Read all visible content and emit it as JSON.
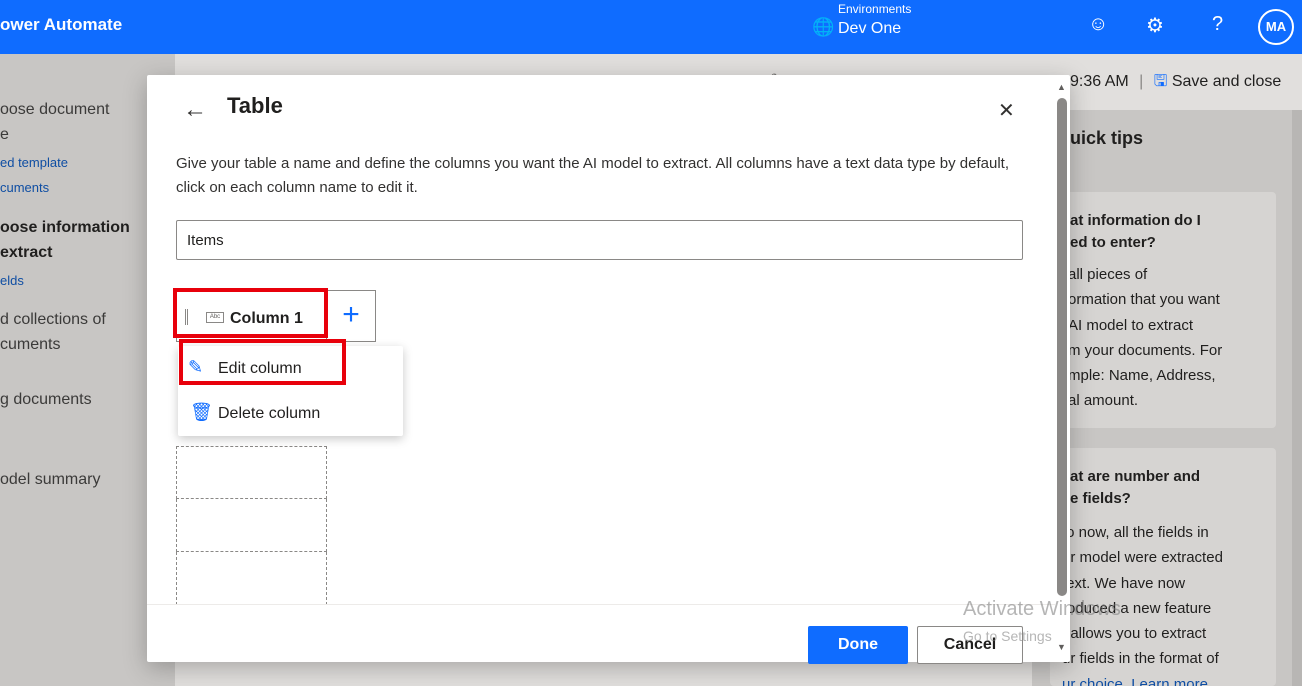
{
  "app": {
    "brand": "ower Automate"
  },
  "topbar": {
    "env_label": "Environments",
    "env_name": "Dev One",
    "avatar": "MA",
    "help": "?"
  },
  "leftnav": {
    "items": [
      {
        "label": "oose document"
      },
      {
        "label": "e"
      },
      {
        "label": "ed template",
        "link": true
      },
      {
        "label": "cuments",
        "link": true
      },
      {
        "label": "oose information",
        "bold": true
      },
      {
        "label": "extract",
        "bold": true
      },
      {
        "label": "elds",
        "link": true
      },
      {
        "label": "d collections of"
      },
      {
        "label": "cuments"
      },
      {
        "label": "g documents"
      },
      {
        "label": "odel summary"
      }
    ]
  },
  "toolbar": {
    "save_status": "9:36 AM",
    "save_close": "Save and close"
  },
  "quick_tips": {
    "title": "uick tips",
    "card1_heading_1": "at information do I",
    "card1_heading_2": "ed to enter?",
    "card1_lines": [
      "all pieces of",
      "ormation that you want",
      "AI model to extract",
      "m your documents. For",
      "mple: Name, Address,",
      "al amount."
    ],
    "card2_heading_1": "at are number and",
    "card2_heading_2": "e fields?",
    "card2_lines": [
      "to now, all the fields in",
      "ur model were extracted",
      "text. We have now",
      "roduced a new feature",
      "t allows you to extract",
      "ur fields in the format of",
      "ur choice. Learn more"
    ]
  },
  "modal": {
    "title": "Table",
    "description": "Give your table a name and define the columns you want the AI model to extract. All columns have a text data type by default, click on each column name to edit it.",
    "table_name": "Items",
    "column_type_icon": "Abc",
    "column_label": "Column 1",
    "menu": {
      "edit": "Edit column",
      "delete": "Delete column"
    },
    "done": "Done",
    "cancel": "Cancel"
  },
  "watermark": {
    "line1": "Activate Windows",
    "line2": "Go to Settings"
  },
  "icons": {
    "environment": "globe-icon",
    "smiley": "smiley-icon",
    "settings": "gear-icon",
    "back": "arrow-left-icon",
    "close": "close-icon",
    "add": "plus-icon",
    "edit": "pencil-icon",
    "delete": "trash-icon",
    "save": "save-icon"
  },
  "colors": {
    "brand_blue": "#0f6cff",
    "highlight_red": "#e8000b"
  }
}
